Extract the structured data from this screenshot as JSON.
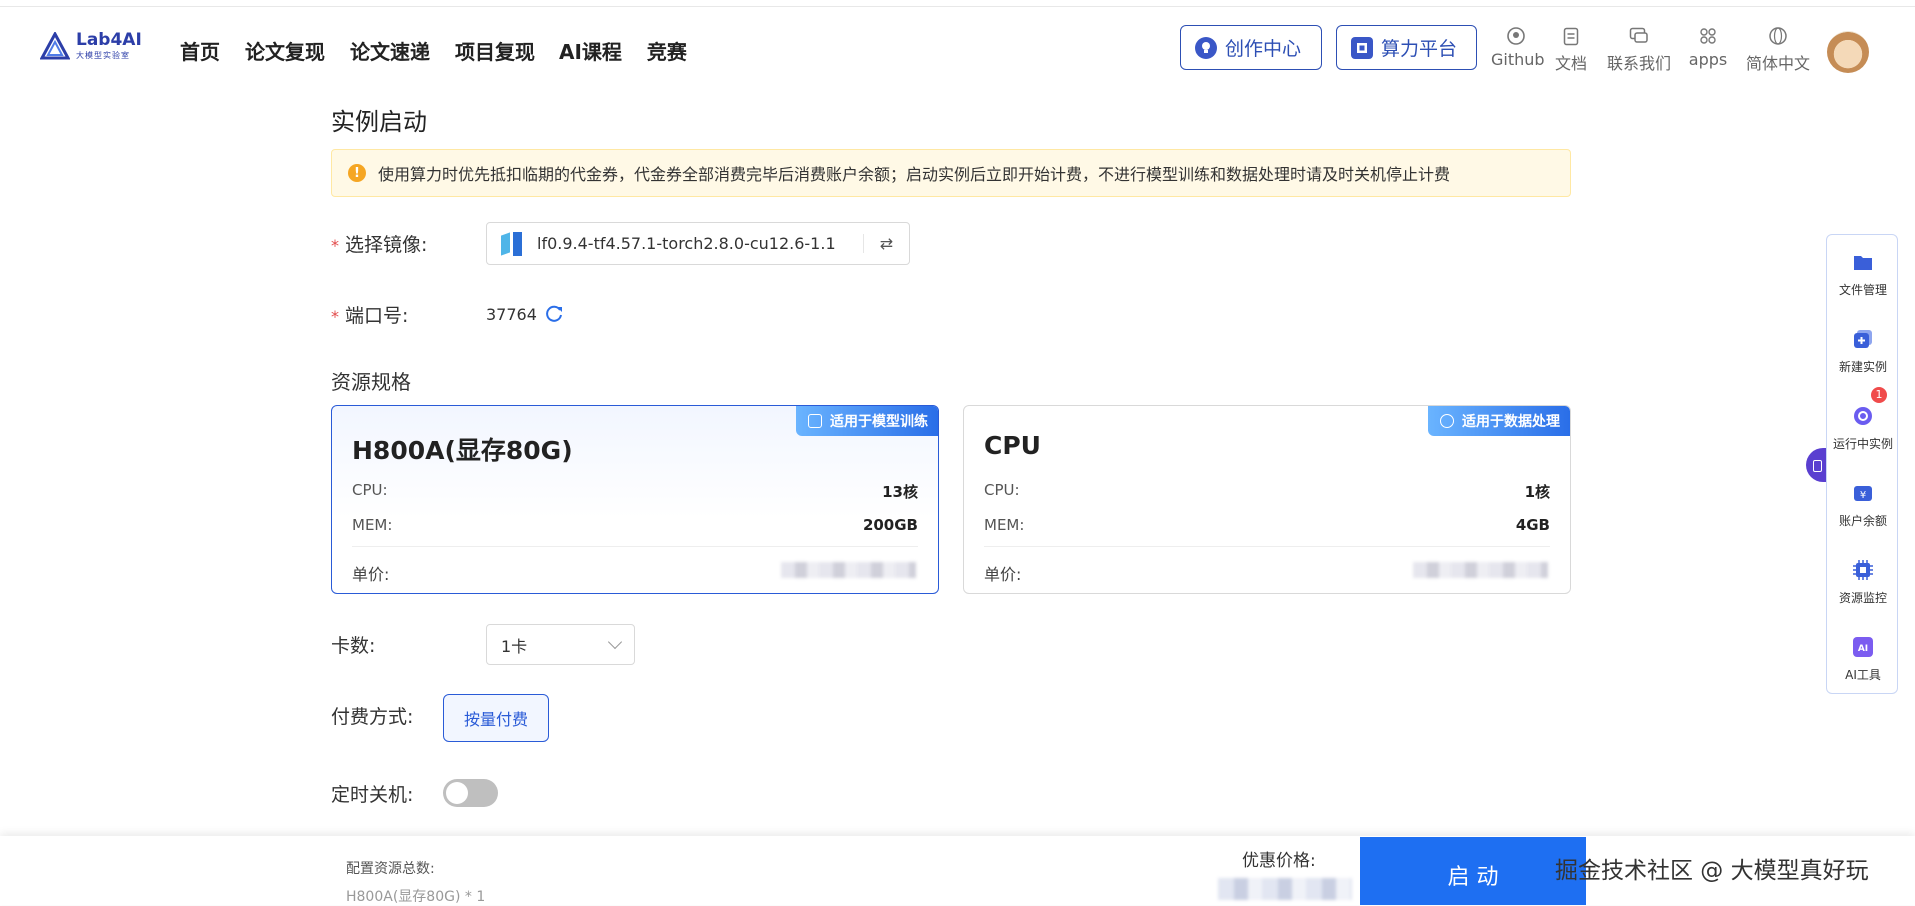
{
  "header": {
    "logo_name": "Lab4AI",
    "logo_sub": "大模型实验室",
    "nav": [
      "首页",
      "论文复现",
      "论文速递",
      "项目复现",
      "AI课程",
      "竞赛"
    ],
    "create_center": "创作中心",
    "compute_platform": "算力平台",
    "links": {
      "github": "Github",
      "docs": "文档",
      "contact": "联系我们",
      "apps": "apps",
      "language": "简体中文"
    }
  },
  "page": {
    "title": "实例启动",
    "alert": "使用算力时优先抵扣临期的代金券，代金券全部消费完毕后消费账户余额；启动实例后立即开始计费，不进行模型训练和数据处理时请及时关机停止计费"
  },
  "form": {
    "image_label": "选择镜像:",
    "image_value": "lf0.9.4-tf4.57.1-torch2.8.0-cu12.6-1.1",
    "port_label": "端口号:",
    "port_value": "37764",
    "resource_title": "资源规格",
    "cards": [
      {
        "tag": "适用于模型训练",
        "title": "H800A(显存80G)",
        "cpu_label": "CPU:",
        "cpu_value": "13核",
        "mem_label": "MEM:",
        "mem_value": "200GB",
        "price_label": "单价:"
      },
      {
        "tag": "适用于数据处理",
        "title": "CPU",
        "cpu_label": "CPU:",
        "cpu_value": "1核",
        "mem_label": "MEM:",
        "mem_value": "4GB",
        "price_label": "单价:"
      }
    ],
    "cards_label": "卡数:",
    "cards_value": "1卡",
    "pay_label": "付费方式:",
    "pay_value": "按量付费",
    "shutdown_label": "定时关机:"
  },
  "sidebar": {
    "items": [
      "文件管理",
      "新建实例",
      "运行中实例",
      "账户余额",
      "资源监控",
      "AI工具"
    ],
    "running_badge": "1"
  },
  "bottom": {
    "total_label": "配置资源总数:",
    "total_value": "H800A(显存80G) * 1",
    "price_label": "优惠价格:",
    "start_label": "启 动",
    "watermark": "掘金技术社区 @ 大模型真好玩"
  },
  "colors": {
    "brand": "#2d4fb4",
    "primary": "#1e6ff2",
    "alert_bg": "#fff9e6",
    "required": "#e24a4a"
  }
}
